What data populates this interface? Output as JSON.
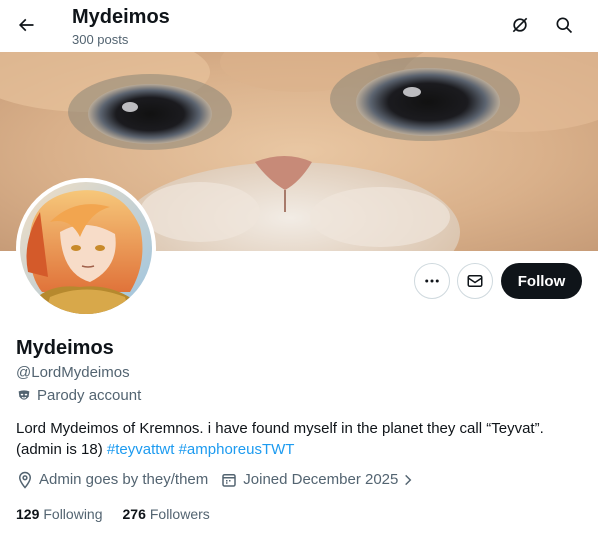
{
  "header": {
    "display_name": "Mydeimos",
    "post_count": "300 posts"
  },
  "profile": {
    "display_name": "Mydeimos",
    "handle": "@LordMydeimos",
    "label": "Parody account",
    "bio_text": "Lord Mydeimos of Kremnos. i have found myself in the planet they call “Teyvat”. (admin is 18) ",
    "hashtag_1": "#teyvattwt",
    "hashtag_2": "#amphoreusTWT",
    "pronouns": "Admin goes by they/them",
    "joined": "Joined December 2025",
    "following_count": "129",
    "following_label": "Following",
    "followers_count": "276",
    "followers_label": "Followers"
  },
  "actions": {
    "follow_label": "Follow"
  },
  "colors": {
    "link": "#1d9bf0",
    "follow_bg": "#0f1419",
    "secondary_text": "#536471"
  },
  "icons": [
    "back-arrow-icon",
    "grok-icon",
    "search-icon",
    "more-icon",
    "mail-icon",
    "parody-mask-icon",
    "location-icon",
    "calendar-icon",
    "chevron-right-icon"
  ]
}
